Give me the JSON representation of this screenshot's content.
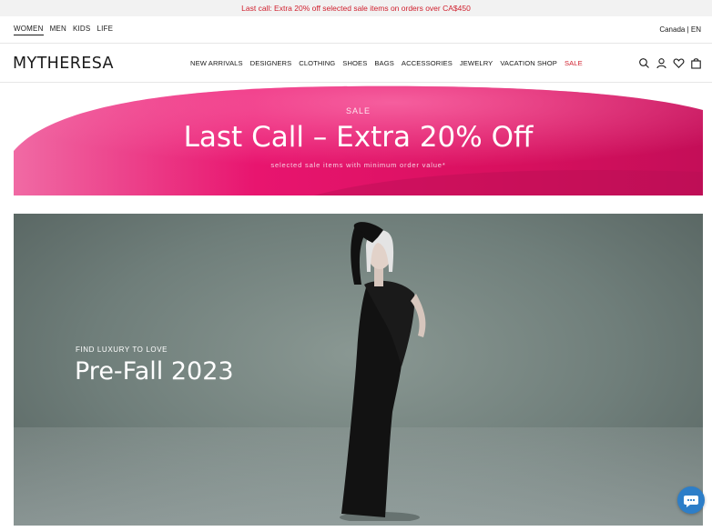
{
  "promo": {
    "text": "Last call: Extra 20% off selected sale items on orders over CA$450"
  },
  "gender_nav": [
    "WOMEN",
    "MEN",
    "KIDS",
    "LIFE"
  ],
  "locale": "Canada | EN",
  "logo": "MYTHERESA",
  "categories": [
    "NEW ARRIVALS",
    "DESIGNERS",
    "CLOTHING",
    "SHOES",
    "BAGS",
    "ACCESSORIES",
    "JEWELRY",
    "VACATION SHOP",
    "SALE"
  ],
  "icons": [
    "search-icon",
    "account-icon",
    "wishlist-icon",
    "bag-icon"
  ],
  "sale_banner": {
    "kicker": "SALE",
    "headline": "Last Call – Extra 20% Off",
    "subtext": "selected sale items with minimum order value*"
  },
  "hero": {
    "kicker": "FIND LUXURY TO LOVE",
    "title": "Pre-Fall 2023"
  },
  "colors": {
    "sale_red": "#d0202e",
    "banner_pink": "#e8156f",
    "chat_blue": "#2d7ec8"
  }
}
